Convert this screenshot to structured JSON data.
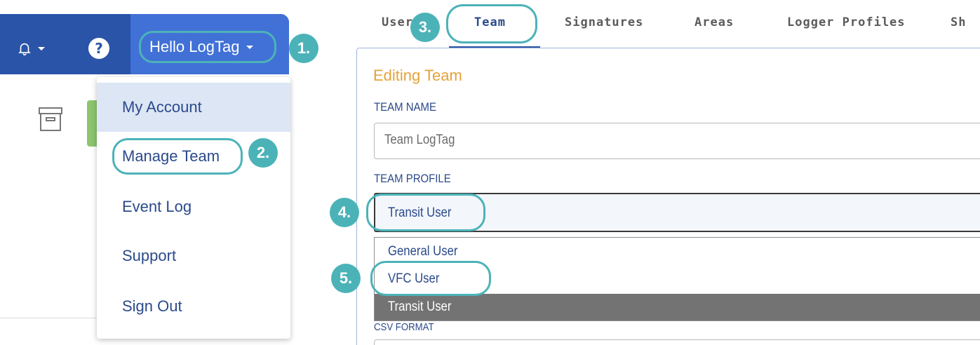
{
  "header": {
    "hello_label": "Hello LogTag",
    "help_glyph": "?"
  },
  "user_menu": {
    "items": [
      {
        "label": "My Account",
        "active": true
      },
      {
        "label": "Manage Team",
        "active": false
      },
      {
        "label": "Event Log",
        "active": false
      },
      {
        "label": "Support",
        "active": false
      },
      {
        "label": "Sign Out",
        "active": false
      }
    ]
  },
  "tabs": [
    {
      "label": "Users"
    },
    {
      "label": "Team",
      "active": true
    },
    {
      "label": "Signatures"
    },
    {
      "label": "Areas"
    },
    {
      "label": "Logger Profiles"
    },
    {
      "label": "Sh"
    }
  ],
  "editor": {
    "title": "Editing Team",
    "team_name_label": "TEAM NAME",
    "team_name_value": "Team LogTag",
    "team_profile_label": "TEAM PROFILE",
    "team_profile_value": "Transit User",
    "profile_options": [
      "General User",
      "VFC User",
      "Transit User"
    ],
    "csv_format_label": "CSV FORMAT"
  },
  "steps": [
    "1.",
    "2.",
    "3.",
    "4.",
    "5."
  ],
  "colors": {
    "header_bg": "#2a54a8",
    "hello_bg": "#4171d6",
    "highlight_teal": "#4bb3b8",
    "title_orange": "#e5a23a",
    "link_blue": "#2b4a8a"
  }
}
